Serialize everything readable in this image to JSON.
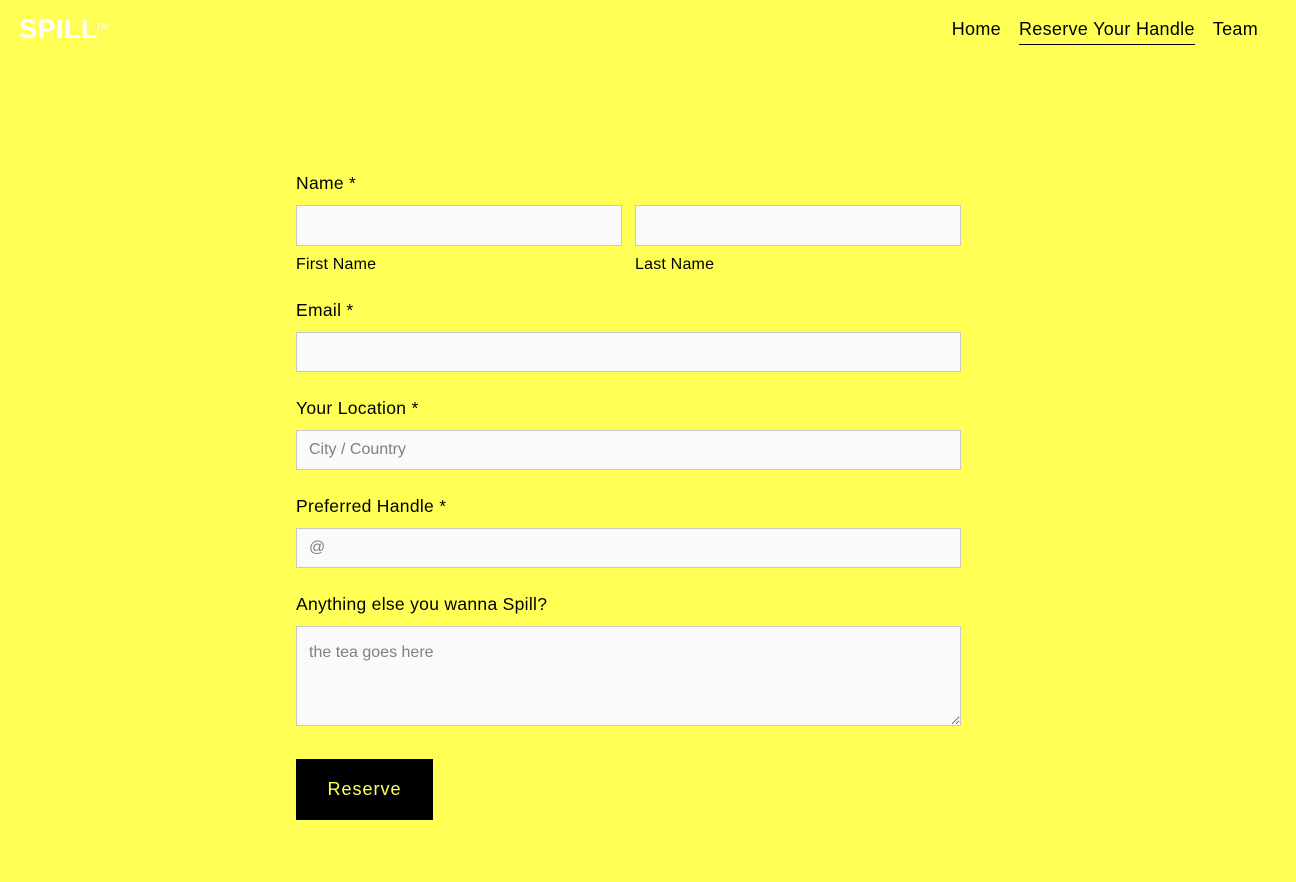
{
  "header": {
    "logo": "SPILL",
    "trademark": "TM",
    "nav": [
      {
        "label": "Home",
        "active": false
      },
      {
        "label": "Reserve Your Handle",
        "active": true
      },
      {
        "label": "Team",
        "active": false
      }
    ]
  },
  "form": {
    "name": {
      "label": "Name *",
      "first_sublabel": "First Name",
      "last_sublabel": "Last Name",
      "first_value": "",
      "last_value": ""
    },
    "email": {
      "label": "Email *",
      "value": ""
    },
    "location": {
      "label": "Your Location *",
      "placeholder": "City / Country",
      "value": ""
    },
    "handle": {
      "label": "Preferred Handle *",
      "placeholder": "@",
      "value": ""
    },
    "message": {
      "label": "Anything else you wanna Spill?",
      "placeholder": "the tea goes here",
      "value": ""
    },
    "submit_label": "Reserve"
  },
  "colors": {
    "background": "#ffff55",
    "button": "#000000",
    "button_text": "#ffff55"
  }
}
